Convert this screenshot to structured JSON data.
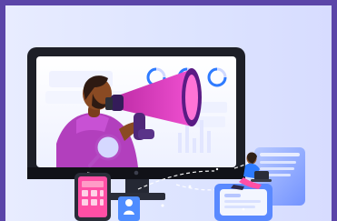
{
  "illustration": {
    "subject": "megaphone-marketing-illustration",
    "colors": {
      "frame": "#5b45a8",
      "background": "#e5e9ff",
      "monitor": "#1d1f27",
      "screen": "#f7f8ff",
      "accent": "#d63ad6",
      "accent_dark": "#3c1766",
      "blue": "#2e7bff",
      "skin": "#8a4a23"
    }
  }
}
